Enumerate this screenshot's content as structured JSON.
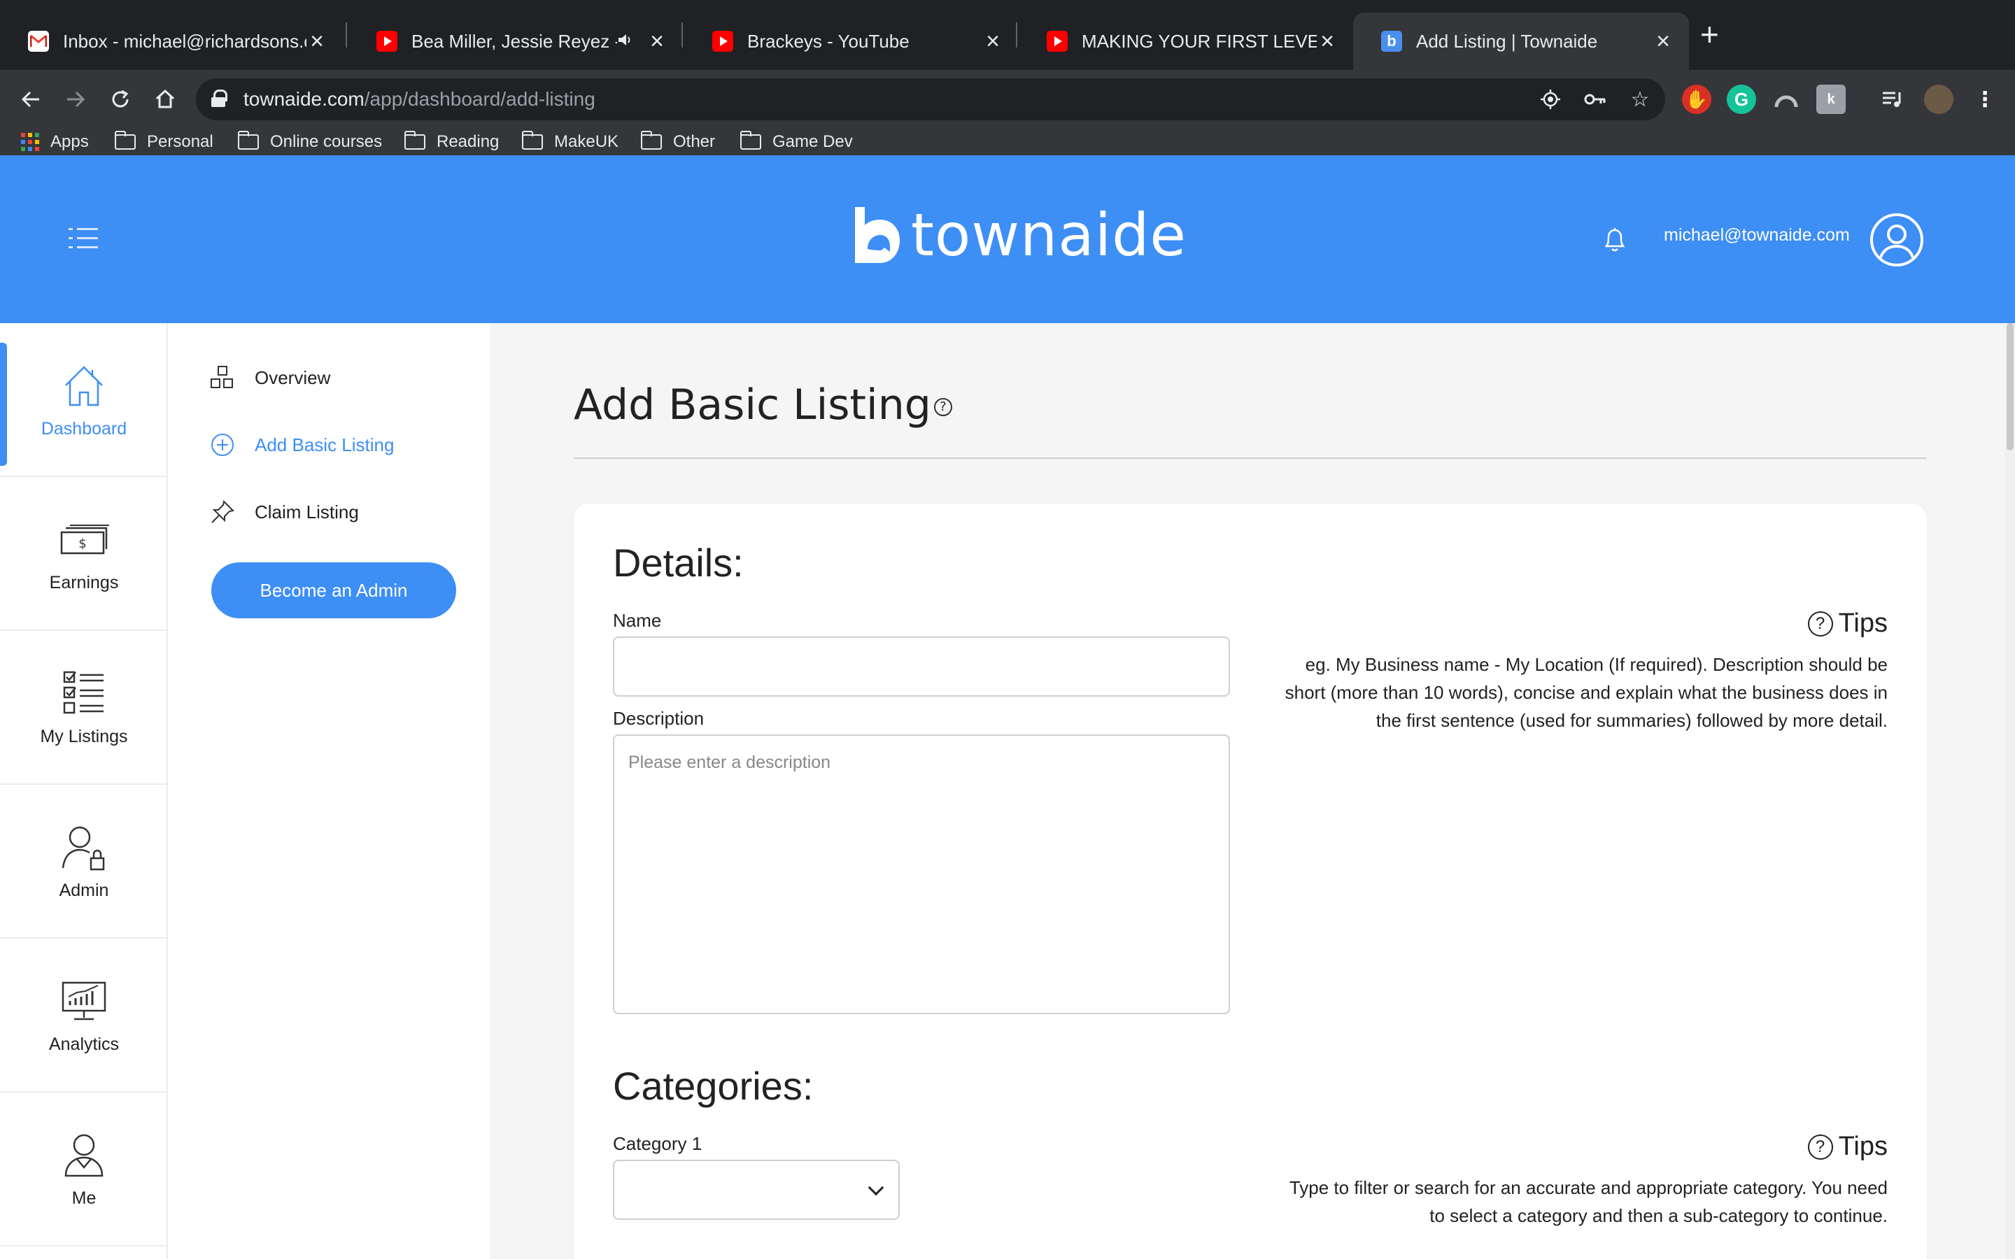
{
  "browser": {
    "tabs": [
      {
        "title": "Inbox - michael@richardsons.co",
        "favicon": "gmail-icon"
      },
      {
        "title": "Bea Miller, Jessie Reyez - FE",
        "favicon": "youtube-icon",
        "audio": true
      },
      {
        "title": "Brackeys - YouTube",
        "favicon": "youtube-icon"
      },
      {
        "title": "MAKING YOUR FIRST LEVEL in U",
        "favicon": "youtube-icon"
      },
      {
        "title": "Add Listing | Townaide",
        "favicon": "townaide-icon",
        "active": true
      }
    ],
    "new_tab": "+",
    "url_host": "townaide.com",
    "url_path": "/app/dashboard/add-listing",
    "bookmarks": [
      "Apps",
      "Personal",
      "Online courses",
      "Reading",
      "MakeUK",
      "Other",
      "Game Dev"
    ]
  },
  "header": {
    "brand": "townaide",
    "user_email": "michael@townaide.com",
    "brand_color": "#3d8ef5"
  },
  "rail": {
    "items": [
      {
        "label": "Dashboard",
        "icon": "house-icon",
        "active": true
      },
      {
        "label": "Earnings",
        "icon": "money-icon"
      },
      {
        "label": "My Listings",
        "icon": "checklist-icon"
      },
      {
        "label": "Admin",
        "icon": "admin-lock-icon"
      },
      {
        "label": "Analytics",
        "icon": "analytics-monitor-icon"
      },
      {
        "label": "Me",
        "icon": "person-icon"
      }
    ]
  },
  "submenu": {
    "items": [
      {
        "label": "Overview",
        "icon": "blocks-icon"
      },
      {
        "label": "Add Basic Listing",
        "icon": "plus-circle-icon",
        "active": true
      },
      {
        "label": "Claim Listing",
        "icon": "pin-icon"
      }
    ],
    "admin_button": "Become an Admin"
  },
  "main": {
    "title": "Add Basic Listing",
    "help_glyph": "?",
    "details": {
      "heading": "Details:",
      "name_label": "Name",
      "name_value": "",
      "description_label": "Description",
      "description_placeholder": "Please enter a description",
      "tips_label": "Tips",
      "tips_text": "eg. My Business name - My Location (If required). Description should be short (more than 10 words), concise and explain what the business does in the first sentence (used for summaries) followed by more detail."
    },
    "categories": {
      "heading": "Categories:",
      "category1_label": "Category 1",
      "category1_value": "",
      "tips_label": "Tips",
      "tips_text": "Type to filter or search for an accurate and appropriate category. You need to select a category and then a sub-category to continue."
    }
  }
}
